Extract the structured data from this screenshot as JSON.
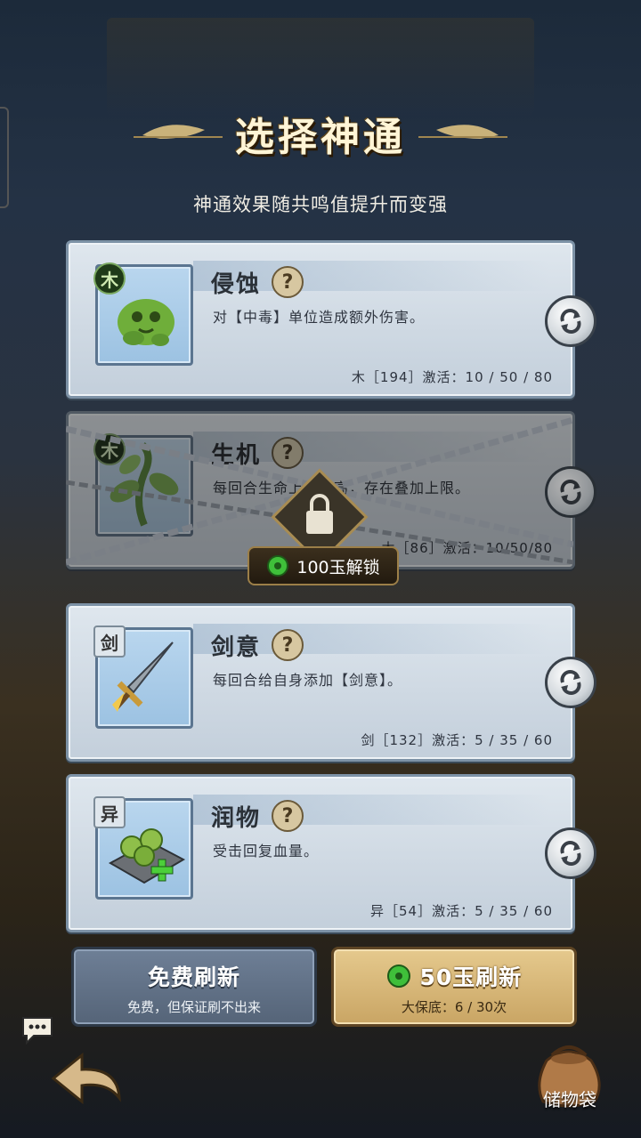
{
  "header": {
    "title": "选择神通",
    "subtitle": "神通效果随共鸣值提升而变强"
  },
  "abilities": [
    {
      "name": "侵蚀",
      "element": "木",
      "desc": "对【中毒】单位造成额外伤害。",
      "stat": "木［194］激活：10 / 50 / 80",
      "locked": false,
      "icon": "poison-slime-icon"
    },
    {
      "name": "生机",
      "element": "木",
      "desc": "每回合生命上限提高，存在叠加上限。",
      "stat": "木［86］激活：10/50/80",
      "locked": true,
      "icon": "vine-sprout-icon"
    },
    {
      "name": "剑意",
      "element": "剑",
      "desc": "每回合给自身添加【剑意】。",
      "stat": "剑［132］激活：5 / 35 / 60",
      "locked": false,
      "icon": "sword-icon"
    },
    {
      "name": "润物",
      "element": "异",
      "desc": "受击回复血量。",
      "stat": "异［54］激活：5 / 35 / 60",
      "locked": false,
      "icon": "herb-heal-icon"
    }
  ],
  "unlock": {
    "label": "100玉解锁"
  },
  "buttons": {
    "free": {
      "label": "免费刷新",
      "sub": "免费，但保证刷不出来"
    },
    "paid": {
      "label": "50玉刷新",
      "sub": "大保底：6 / 30次"
    }
  },
  "bag": {
    "label": "储物袋"
  },
  "colors": {
    "paid_button": "#d8b878",
    "free_button": "#627389",
    "jade": "#3fbf3a"
  }
}
